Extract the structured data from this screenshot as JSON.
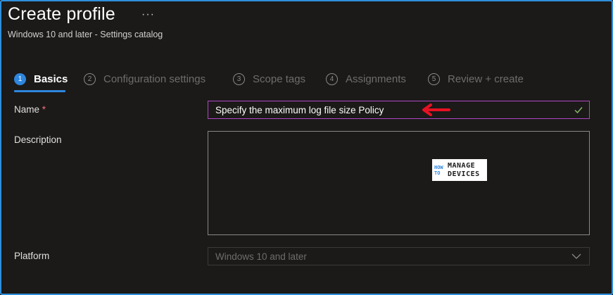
{
  "header": {
    "title": "Create profile",
    "more_label": "···",
    "subtitle": "Windows 10 and later - Settings catalog"
  },
  "steps": [
    {
      "num": "1",
      "label": "Basics",
      "active": true
    },
    {
      "num": "2",
      "label": "Configuration settings",
      "active": false
    },
    {
      "num": "3",
      "label": "Scope tags",
      "active": false
    },
    {
      "num": "4",
      "label": "Assignments",
      "active": false
    },
    {
      "num": "5",
      "label": "Review + create",
      "active": false
    }
  ],
  "form": {
    "name_label": "Name",
    "required_mark": "*",
    "name_value": "Specify the maximum log file size Policy",
    "description_label": "Description",
    "description_value": "",
    "platform_label": "Platform",
    "platform_value": "Windows 10 and later"
  },
  "watermark": {
    "small_top": "HOW",
    "small_bottom": "TO",
    "line1": "MANAGE",
    "line2": "DEVICES"
  },
  "colors": {
    "accent": "#2e86de",
    "focus_border": "#b146c2",
    "annotation_arrow": "#e81123",
    "valid_check": "#8cbd6c"
  },
  "icons": {
    "name_valid": "checkmark-icon",
    "platform_dropdown": "chevron-down-icon",
    "annotation": "red-arrow-icon"
  }
}
